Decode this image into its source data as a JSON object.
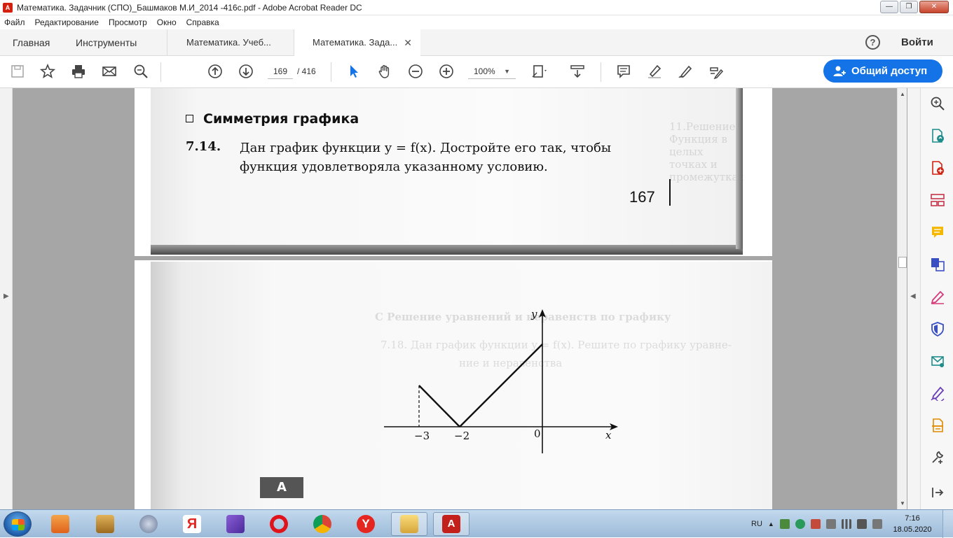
{
  "window": {
    "title": "Математика. Задачник (СПО)_Башмаков М.И_2014 -416с.pdf - Adobe Acrobat Reader DC",
    "minimize": "—",
    "restore": "❐",
    "close": "✕"
  },
  "menu": [
    "Файл",
    "Редактирование",
    "Просмотр",
    "Окно",
    "Справка"
  ],
  "tabs": {
    "home": "Главная",
    "tools": "Инструменты",
    "doc1": "Математика. Учеб...",
    "doc2": "Математика. Зада...",
    "close": "✕"
  },
  "header": {
    "help": "?",
    "signin": "Войти"
  },
  "toolbar": {
    "page_current": "169",
    "page_total": "/  416",
    "zoom": "100%",
    "share_label": "Общий доступ",
    "icons": [
      "save-icon",
      "star-icon",
      "print-icon",
      "mail-icon",
      "search-zoom-icon",
      "arrow-up-icon",
      "arrow-down-icon",
      "select-cursor-icon",
      "hand-icon",
      "zoom-out-icon",
      "zoom-in-icon",
      "page-fit-icon",
      "scroll-mode-icon",
      "comment-icon",
      "highlight-icon",
      "sign-icon",
      "edit-protect-icon"
    ]
  },
  "document": {
    "page1": {
      "heading": "Симметрия графика",
      "problem_number": "7.14.",
      "problem_line1": "Дан график функции y = f(x). Достройте его так, чтобы",
      "problem_line2": "функция удовлетворяла указанному условию.",
      "page_number": "167"
    },
    "page2": {
      "ghost_heading": "С  Решение уравнений и неравенств по графику",
      "ghost_problem": "7.18. Дан график функции y = f(x). Решите по графику уравне-",
      "ghost_problem2": "ние и неравенства",
      "badge": "А",
      "graph": {
        "axis_x": "x",
        "axis_y": "y",
        "label_origin": "0",
        "label_m3": "−3",
        "label_m2": "−2"
      }
    }
  },
  "right_pane_icons": [
    "zoom-search-icon",
    "export-pdf-icon",
    "create-pdf-icon",
    "organize-pages-icon",
    "comment-icon",
    "combine-icon",
    "fill-sign-icon",
    "protect-icon",
    "send-track-icon",
    "signature-icon",
    "scan-icon",
    "more-tools-icon",
    "collapse-pane-icon"
  ],
  "taskbar": {
    "lang": "RU",
    "time": "7:16",
    "date": "18.05.2020"
  },
  "colors": {
    "accent": "#1473e6",
    "icon_blue": "#1473e6",
    "taskbar": "#aac6e2"
  }
}
